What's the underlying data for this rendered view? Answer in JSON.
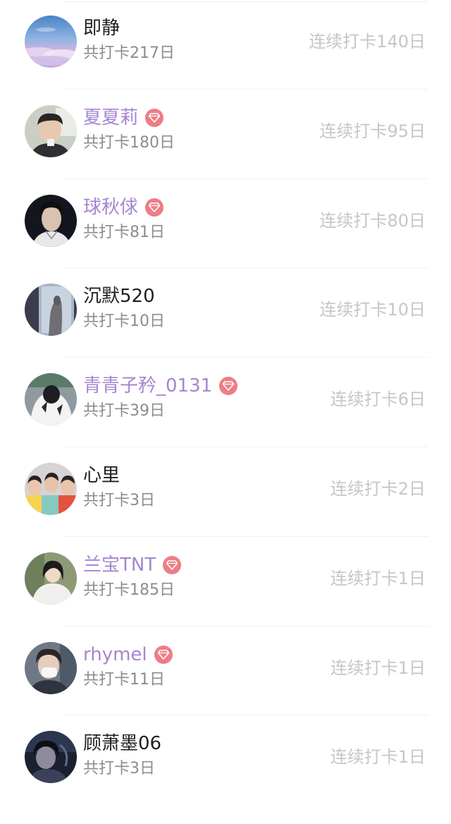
{
  "accent": {
    "vip_name_color": "#a586cf",
    "badge_color": "#ee7d86",
    "name_color": "#1f1f1f",
    "total_color": "#8c8c8c",
    "streak_color": "#c6c6c6"
  },
  "users": [
    {
      "name": "即静",
      "vip": false,
      "total": "共打卡217日",
      "streak": "连续打卡140日",
      "avatar": "sky-clouds-photo"
    },
    {
      "name": "夏夏莉",
      "vip": true,
      "total": "共打卡180日",
      "streak": "连续打卡95日",
      "avatar": "young-man-photo"
    },
    {
      "name": "球秋俅",
      "vip": true,
      "total": "共打卡81日",
      "streak": "连续打卡80日",
      "avatar": "costume-portrait-photo"
    },
    {
      "name": "沉默520",
      "vip": false,
      "total": "共打卡10日",
      "streak": "连续打卡10日",
      "avatar": "window-silhouette-photo"
    },
    {
      "name": "青青子矜_0131",
      "vip": true,
      "total": "共打卡39日",
      "streak": "连续打卡6日",
      "avatar": "person-white-hoodie-photo"
    },
    {
      "name": "心里",
      "vip": false,
      "total": "共打卡3日",
      "streak": "连续打卡2日",
      "avatar": "three-friends-photo"
    },
    {
      "name": "兰宝TNT",
      "vip": true,
      "total": "共打卡185日",
      "streak": "连续打卡1日",
      "avatar": "girl-portrait-photo"
    },
    {
      "name": "rhymel",
      "vip": true,
      "total": "共打卡11日",
      "streak": "连续打卡1日",
      "avatar": "masked-person-photo"
    },
    {
      "name": "顾萧墨06",
      "vip": false,
      "total": "共打卡3日",
      "streak": "连续打卡1日",
      "avatar": "dark-portrait-photo"
    }
  ]
}
